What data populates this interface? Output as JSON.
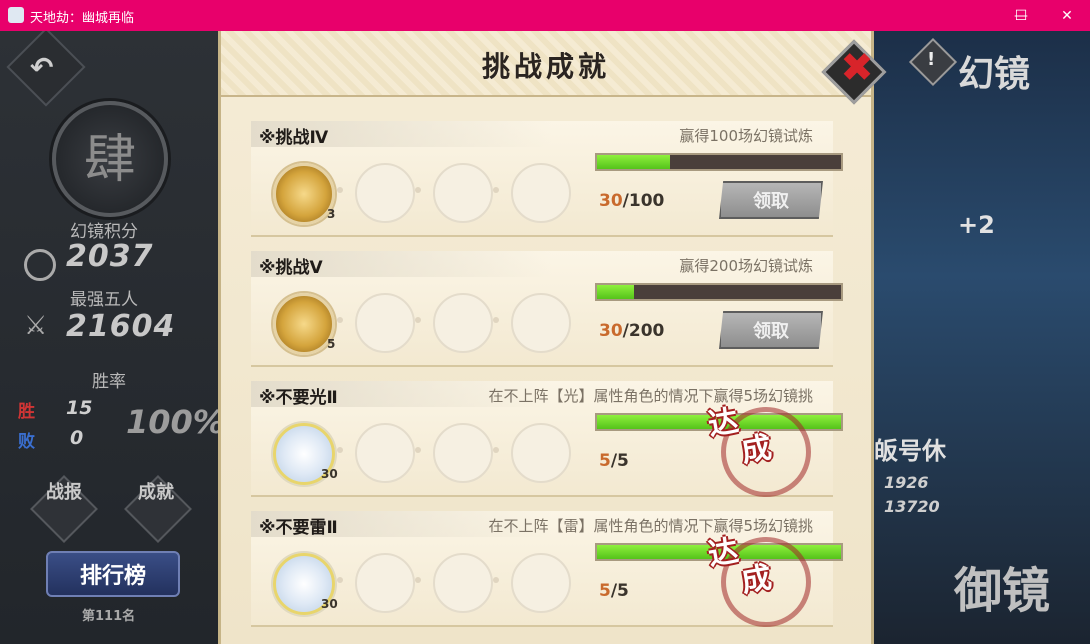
{
  "window": {
    "title": "天地劫：幽城再临",
    "minimize": "—",
    "maximize": "☐",
    "close": "✕"
  },
  "left": {
    "rank_char": "肆",
    "score_label": "幻镜积分",
    "score_value": "2037",
    "top5_label": "最强五人",
    "top5_value": "21604",
    "winrate_label": "胜率",
    "win_label": "胜",
    "win_value": "15",
    "loss_label": "败",
    "loss_value": "0",
    "winrate_value": "100%",
    "btn_report": "战报",
    "btn_achieve": "成就",
    "leaderboard_btn": "排行榜",
    "rank_position": "第111名"
  },
  "right": {
    "title": "幻镜",
    "alert": "!",
    "plus": "+2",
    "hero_name": "皈号休",
    "stat1": "1926",
    "stat2": "13720",
    "bottom_title": "御镜"
  },
  "modal": {
    "title": "挑战成就",
    "close_icon": "✖",
    "items": [
      {
        "name": "※挑战Ⅳ",
        "desc": "赢得100场幻镜试炼",
        "reward_count": "3",
        "current": "30",
        "total": "/100",
        "progress": 0.3,
        "status": "claim",
        "claim_label": "领取"
      },
      {
        "name": "※挑战Ⅴ",
        "desc": "赢得200场幻镜试炼",
        "reward_count": "5",
        "current": "30",
        "total": "/200",
        "progress": 0.15,
        "status": "claim",
        "claim_label": "领取"
      },
      {
        "name": "※不要光Ⅱ",
        "desc": "在不上阵【光】属性角色的情况下赢得5场幻镜挑",
        "reward_count": "30",
        "current": "5",
        "total": "/5",
        "progress": 1.0,
        "status": "done",
        "done_label_1": "达",
        "done_label_2": "成"
      },
      {
        "name": "※不要雷Ⅱ",
        "desc": "在不上阵【雷】属性角色的情况下赢得5场幻镜挑",
        "reward_count": "30",
        "current": "5",
        "total": "/5",
        "progress": 1.0,
        "status": "done",
        "done_label_1": "达",
        "done_label_2": "成"
      }
    ]
  },
  "colors": {
    "titlebar": "#e8006b",
    "progress_fill": "#6fdc25",
    "current_value": "#c96a2d",
    "stamp": "#a32020"
  },
  "icons": {
    "back": "back-arrow-icon",
    "close": "close-x-icon",
    "reward_coin": "gold-coin-icon",
    "reward_star": "crystal-star-icon"
  }
}
